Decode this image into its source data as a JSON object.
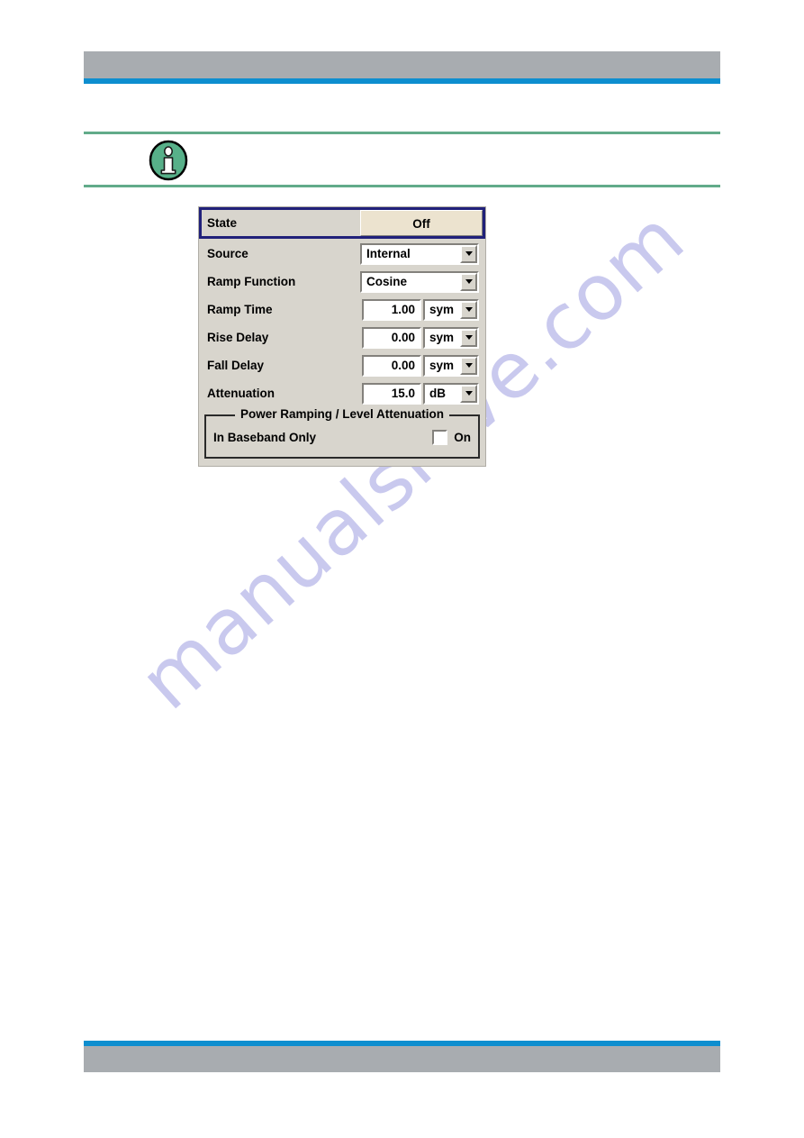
{
  "theme": {
    "header_bar_color": "#a8acb0",
    "header_rule_color": "#0d8ecf",
    "note_rule_color": "#62ab8a",
    "info_icon_fill": "#57b089",
    "dialog_background": "#d8d5cd",
    "focus_border_color": "#21217a",
    "state_button_color": "#ece3cf",
    "watermark_color": "#c9c9ee"
  },
  "watermark": {
    "text": "manualshive.com"
  },
  "note": {
    "icon": "info-icon",
    "text": ""
  },
  "dialog": {
    "name": "power-ramping-dialog",
    "rows": [
      {
        "label": "State",
        "type": "toggle-button",
        "value": "Off",
        "focused": true
      },
      {
        "label": "Source",
        "type": "combo",
        "value": "Internal"
      },
      {
        "label": "Ramp Function",
        "type": "combo",
        "value": "Cosine"
      },
      {
        "label": "Ramp Time",
        "type": "numeric",
        "value": "1.00",
        "unit": "sym"
      },
      {
        "label": "Rise Delay",
        "type": "numeric",
        "value": "0.00",
        "unit": "sym"
      },
      {
        "label": "Fall Delay",
        "type": "numeric",
        "value": "0.00",
        "unit": "sym"
      },
      {
        "label": "Attenuation",
        "type": "numeric",
        "value": "15.0",
        "unit": "dB"
      }
    ],
    "group": {
      "legend": "Power Ramping / Level Attenuation",
      "row": {
        "label": "In Baseband Only",
        "checkbox_label": "On",
        "checked": false
      }
    }
  }
}
